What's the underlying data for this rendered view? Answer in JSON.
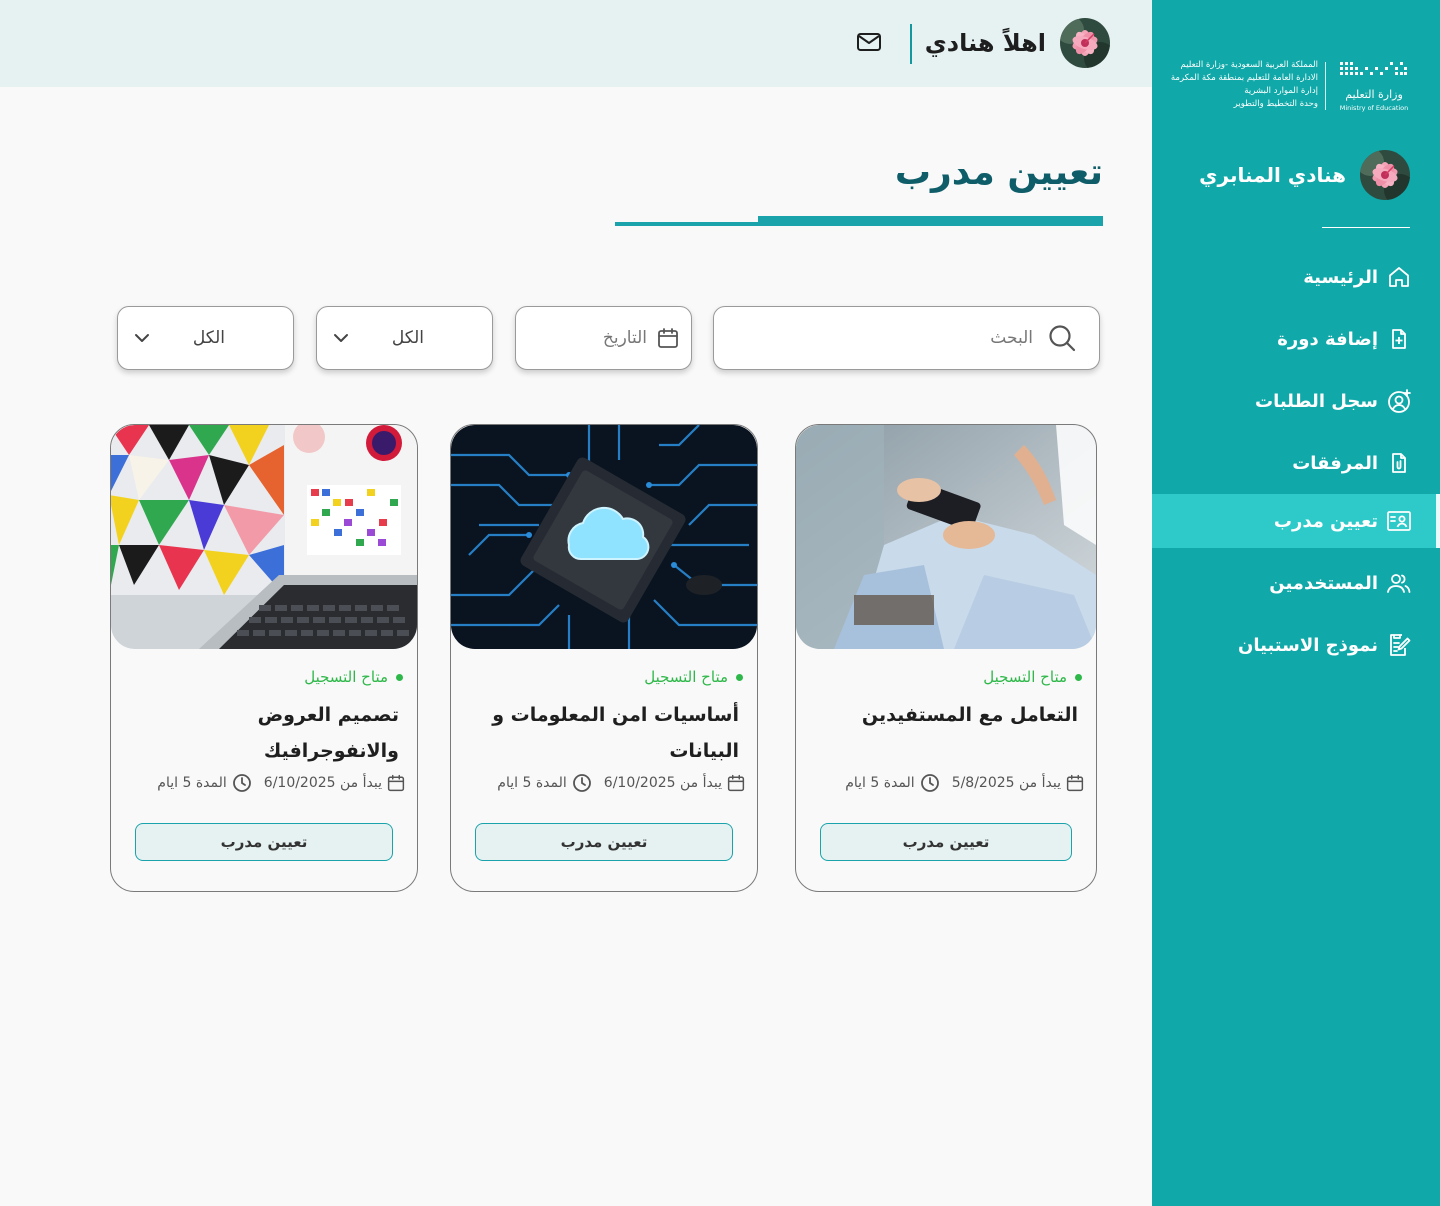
{
  "sidebar": {
    "logo": {
      "lines": [
        "المملكة العربية السعودية -وزارة التعليم",
        "الادارة العامة للتعليم بمنطقة مكة المكرمة",
        "إدارة الموارد البشرية",
        "وحدة التخطيط والتطوير"
      ],
      "ministry_ar": "وزارة التعليم",
      "ministry_en": "Ministry of Education"
    },
    "profile_name": "هنادي المنابري",
    "items": [
      {
        "label": "الرئيسية",
        "icon": "home-icon"
      },
      {
        "label": "إضافة دورة",
        "icon": "file-plus-icon"
      },
      {
        "label": "سجل الطلبات",
        "icon": "user-plus-circle-icon"
      },
      {
        "label": "المرفقات",
        "icon": "attachment-file-icon"
      },
      {
        "label": "تعيين مدرب",
        "icon": "trainer-board-icon",
        "active": true
      },
      {
        "label": "المستخدمين",
        "icon": "users-icon"
      },
      {
        "label": "نموذج الاستبيان",
        "icon": "survey-edit-icon"
      }
    ]
  },
  "header": {
    "greeting": "اهلاً هنادي",
    "mail_icon": "mail-icon"
  },
  "page": {
    "title": "تعيين مدرب"
  },
  "filters": {
    "search_placeholder": "البحث",
    "date_placeholder": "التاريخ",
    "select1_value": "الكل",
    "select2_value": "الكل"
  },
  "colors": {
    "sidebar": "#10a8a8",
    "active_item": "#2ec9c9",
    "topbar": "#e6f2f2",
    "title": "#0e5d69",
    "accent": "#1aa3ab",
    "status": "#2fb84a"
  },
  "cards": [
    {
      "status": "متاح التسجيل",
      "title": "التعامل مع المستفيدين",
      "start": "يبدأ من 5/8/2025",
      "duration": "المدة 5 ايام",
      "button": "تعيين مدرب"
    },
    {
      "status": "متاح التسجيل",
      "title": "أساسيات امن المعلومات و البيانات",
      "start": "يبدأ من 6/10/2025",
      "duration": "المدة 5 ايام",
      "button": "تعيين مدرب"
    },
    {
      "status": "متاح التسجيل",
      "title": "تصميم العروض والانفوجرافيك",
      "start": "يبدأ من 6/10/2025",
      "duration": "المدة 5 ايام",
      "button": "تعيين مدرب"
    }
  ]
}
